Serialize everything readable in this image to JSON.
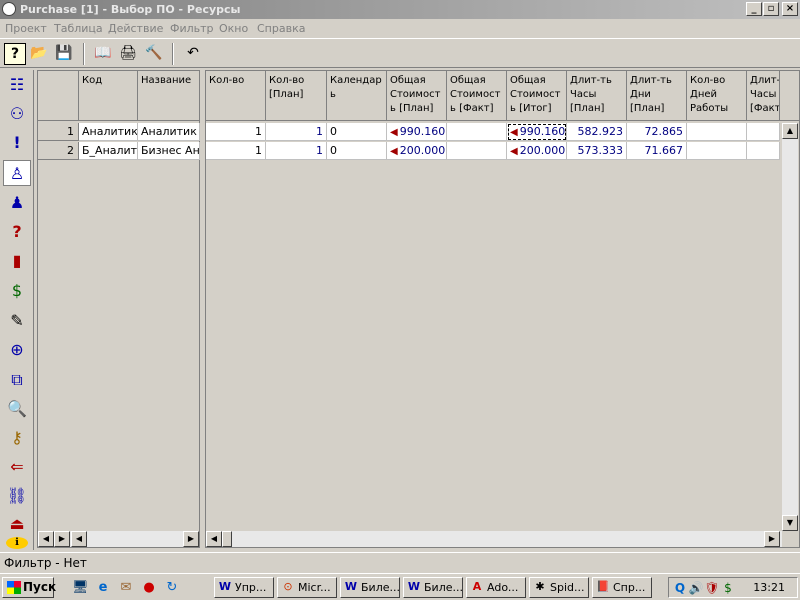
{
  "window": {
    "title": "Purchase [1] - Выбор ПО - Ресурсы",
    "min_glyph": "_",
    "max_glyph": "▫",
    "close_glyph": "×"
  },
  "menu": [
    "Проект",
    "Таблица",
    "Действие",
    "Фильтр",
    "Окно",
    "Справка"
  ],
  "toolbar": {
    "icons": [
      "help-icon",
      "open-folder-icon",
      "save-icon",
      "book-icon",
      "print-icon",
      "hammer-icon",
      "undo-icon"
    ],
    "glyphs": [
      "?",
      "📂",
      "💾",
      "📖",
      "🖨",
      "🔨",
      "↶"
    ]
  },
  "leftbar": {
    "icons": [
      "hierarchy-icon",
      "org-chart-icon",
      "alert-icon",
      "resource-person-icon",
      "group-icon",
      "question-group-icon",
      "book-red-icon",
      "cost-icon",
      "calendar-note-icon",
      "calendar-globe-icon",
      "calendar-link-icon",
      "calendar-search-icon",
      "calendar-key-icon",
      "calendar-arrow-icon",
      "chain-icon",
      "exit-icon",
      "info-icon"
    ],
    "glyphs": [
      "☷",
      "⚇",
      "!",
      "♙",
      "♟",
      "?",
      "▮",
      "$",
      "✎",
      "⊕",
      "⧉",
      "🔍",
      "⚷",
      "⇐",
      "⛓",
      "⏏",
      "ℹ"
    ]
  },
  "grid_left": {
    "headers": [
      "Код",
      "Название"
    ],
    "rows": [
      {
        "num": "1",
        "code": "Аналитик",
        "name": "Аналитик"
      },
      {
        "num": "2",
        "code": "Б_Аналит",
        "name": "Бизнес Ан"
      }
    ]
  },
  "grid_right": {
    "headers": [
      "Кол-во",
      "Кол-во [План]",
      "Календар ь",
      "Общая Стоимост ь [План]",
      "Общая Стоимост ь [Факт]",
      "Общая Стоимост ь [Итог]",
      "Длит-ть Часы [План]",
      "Длит-ть Дни [План]",
      "Кол-во Дней Работы",
      "Длит- Часы [Факт"
    ],
    "rows": [
      {
        "qty": "1",
        "qty_plan": "1",
        "calendar": "0",
        "cost_plan": "990.160",
        "cost_fact": "",
        "cost_total": "990.160",
        "hours_plan": "582.923",
        "days_plan": "72.865",
        "work_days": "",
        "hours_fact": ""
      },
      {
        "qty": "1",
        "qty_plan": "1",
        "calendar": "0",
        "cost_plan": "200.000",
        "cost_fact": "",
        "cost_total": "200.000",
        "hours_plan": "573.333",
        "days_plan": "71.667",
        "work_days": "",
        "hours_fact": ""
      }
    ]
  },
  "status": {
    "text": "Фильтр -  Нет"
  },
  "taskbar": {
    "start_label": "Пуск",
    "quick_launch": [
      "show-desktop-icon",
      "ie-icon",
      "outlook-icon",
      "media-icon",
      "refresh-icon"
    ],
    "quick_glyphs": [
      "🖥",
      "e",
      "✉",
      "●",
      "↻"
    ],
    "tasks": [
      {
        "label": "Упр...",
        "icon": "W"
      },
      {
        "label": "Micr...",
        "icon": "⊙"
      },
      {
        "label": "Биле...",
        "icon": "W"
      },
      {
        "label": "Биле...",
        "icon": "W"
      },
      {
        "label": "Ado...",
        "icon": "A"
      },
      {
        "label": "Spid...",
        "icon": "✱"
      },
      {
        "label": "Спр...",
        "icon": "📕"
      }
    ],
    "tray_glyphs": [
      "Q",
      "🔊",
      "🛡",
      "$"
    ],
    "clock": "13:21"
  }
}
